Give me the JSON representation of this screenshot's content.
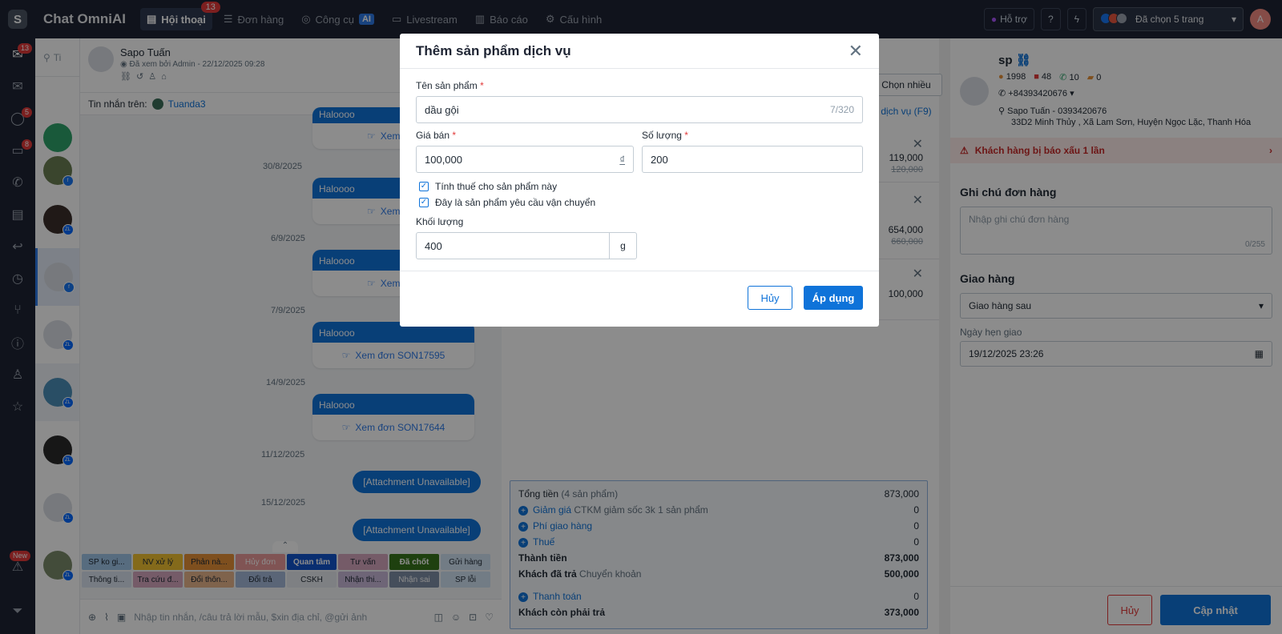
{
  "app": {
    "title": "Chat OmniAI"
  },
  "nav": {
    "tabs": [
      {
        "label": "Hội thoại",
        "badge": "13"
      },
      {
        "label": "Đơn hàng"
      },
      {
        "label": "Công cụ",
        "ai": "AI"
      },
      {
        "label": "Livestream"
      },
      {
        "label": "Báo cáo"
      },
      {
        "label": "Cấu hình"
      }
    ],
    "support": "Hỗ trợ",
    "pages": "Đã chọn 5 trang",
    "user_initial": "A"
  },
  "sidebar": {
    "badges": {
      "inbox": "13",
      "chat": "5",
      "messages": "8",
      "new": "New"
    }
  },
  "chat": {
    "name": "Sapo Tuấn",
    "seen": "Đã xem bởi Admin - 22/12/2025 09:28",
    "source_label": "Tin nhắn trên:",
    "source_page": "Tuanda3",
    "search_placeholder": "Ti",
    "messages": [
      {
        "top": "Haloooo",
        "link": "Xem đơn"
      },
      {
        "date": "30/8/2025",
        "top": "Haloooo",
        "link": "Xem đơn"
      },
      {
        "date": "6/9/2025",
        "top": "Haloooo",
        "link": "Xem đơn"
      },
      {
        "date": "7/9/2025",
        "top": "Haloooo",
        "link": "Xem đơn SON17595"
      },
      {
        "date": "14/9/2025",
        "top": "Haloooo",
        "link": "Xem đơn SON17644"
      }
    ],
    "attachments": [
      {
        "date": "11/12/2025",
        "text": "[Attachment Unavailable]"
      },
      {
        "date": "15/12/2025",
        "text": "[Attachment Unavailable]"
      }
    ],
    "tags": [
      "SP ko gi...",
      "NV xử lý",
      "Phản nà...",
      "Hủy đơn",
      "Quan tâm",
      "Tư vấn",
      "Đã chốt",
      "Gửi hàng",
      "Thông ti...",
      "Tra cứu đ...",
      "Đổi thôn...",
      "Đổi trả",
      "CSKH",
      "Nhận thi...",
      "Nhận sai",
      "SP lỗi"
    ],
    "composer_placeholder": "Nhập tin nhắn, /câu trả lời mẫu, $xin địa chỉ, @gửi ảnh"
  },
  "order": {
    "choose_many": "Chọn nhiều",
    "service_link": "m dịch vụ (F9)",
    "items": [
      {
        "price": "119,000",
        "old_price": "120,000"
      },
      {
        "price": "654,000",
        "old_price": "660,000"
      },
      {
        "price": "100,000"
      }
    ],
    "summary": {
      "total_label": "Tổng tiền",
      "total_count": "(4 sản phẩm)",
      "total": "873,000",
      "discount_label": "Giảm giá",
      "discount_note": "CTKM giảm sốc 3k 1 sản phẩm",
      "discount": "0",
      "shipping_label": "Phí giao hàng",
      "shipping": "0",
      "tax_label": "Thuế",
      "tax": "0",
      "subtotal_label": "Thành tiền",
      "subtotal": "873,000",
      "paid_label": "Khách đã trả",
      "paid_method": "Chuyển khoản",
      "paid": "500,000",
      "payment_label": "Thanh toán",
      "payment": "0",
      "remaining_label": "Khách còn phải trả",
      "remaining": "373,000"
    }
  },
  "customer": {
    "name": "sp",
    "stats": [
      "1998",
      "48",
      "10",
      "0"
    ],
    "phone": "+84393420676",
    "address_name": "Sapo Tuấn - 0393420676",
    "address": "33D2 Minh Thủy , Xã Lam Sơn, Huyện Ngọc Lặc, Thanh Hóa",
    "warning": "Khách hàng bị báo xấu 1 lần",
    "note_title": "Ghi chú đơn hàng",
    "note_placeholder": "Nhập ghi chú đơn hàng",
    "note_count": "0/255",
    "shipping_title": "Giao hàng",
    "shipping_option": "Giao hàng sau",
    "date_label": "Ngày hẹn giao",
    "date_value": "19/12/2025 23:26",
    "cancel": "Hủy",
    "update": "Cập nhật"
  },
  "modal": {
    "title": "Thêm sản phẩm dịch vụ",
    "name_label": "Tên sản phẩm",
    "name_value": "dầu gội",
    "name_count": "7/320",
    "price_label": "Giá bán",
    "price_value": "100,000",
    "currency": "₫",
    "qty_label": "Số lượng",
    "qty_value": "200",
    "tax_check": "Tính thuế cho sản phẩm này",
    "ship_check": "Đây là sản phẩm yêu cầu vận chuyển",
    "weight_label": "Khối lượng",
    "weight_value": "400",
    "weight_unit": "g",
    "cancel": "Hủy",
    "apply": "Áp dụng",
    "required_mark": "*"
  }
}
